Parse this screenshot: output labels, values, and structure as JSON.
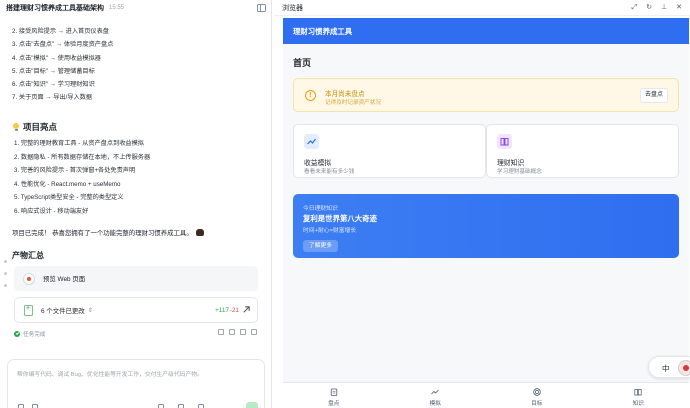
{
  "left": {
    "title": "搭建理财习惯养成工具基础架构",
    "time": "15:55",
    "steps": [
      "2. 接受风险提示 → 进入首页仪表盘",
      "3. 点击\"去盘点\" → 体验月度资产盘点",
      "4. 点击\"模拟\" → 使用收益模拟器",
      "5. 点击\"目标\" → 管理储蓄目标",
      "6. 点击\"知识\" → 学习理财知识",
      "7. 关于页面 → 导出/导入数据"
    ],
    "highlights_title": "项目亮点",
    "highlights": [
      "1. 完整的理财教育工具 - 从资产盘点到收益模拟",
      "2. 数据隐私 - 所有数据存储在本地，不上传服务器",
      "3. 完善的风险提示 - 首次弹窗+各处免责声明",
      "4. 性能优化 - React.memo + useMemo",
      "5. TypeScript类型安全 - 完整的类型定义",
      "6. 响应式设计 - 移动端友好"
    ],
    "done_text": "项目已完成！ 恭喜您拥有了一个功能完整的理财习惯养成工具。",
    "artifacts_title": "产物汇总",
    "preview_label": "预览 Web 页面",
    "changes_label": "6 个文件已更改",
    "additions": "+117",
    "deletions": "-21",
    "status_text": "任务完成",
    "composer_placeholder": "帮你编写代码、调试 Bug、优化性能等开发工作，交付生产级代码产物。"
  },
  "browser": {
    "title": "浏览器"
  },
  "app": {
    "header_title": "理财习惯养成工具",
    "page_title": "首页",
    "notice": {
      "title": "本月尚未盘点",
      "subtitle": "记得及时记录资产状况",
      "button": "去盘点"
    },
    "features": [
      {
        "title": "收益模拟",
        "subtitle": "看看未来能有多少钱"
      },
      {
        "title": "理财知识",
        "subtitle": "学习理财基础概念"
      }
    ],
    "banner": {
      "kicker": "今日理财知识",
      "title": "复利是世界第八大奇迹",
      "subtitle": "时间+耐心=财富增长",
      "button": "了解更多"
    },
    "float_label": "中",
    "tabs": [
      {
        "label": "盘点",
        "icon": "clipboard-icon"
      },
      {
        "label": "模拟",
        "icon": "trend-icon"
      },
      {
        "label": "目标",
        "icon": "target-icon"
      },
      {
        "label": "知识",
        "icon": "book-icon"
      }
    ]
  },
  "colors": {
    "brand_blue": "#2f6ef0",
    "warn_bg": "#fff8e6",
    "warn_text": "#c98a06",
    "add_green": "#2ea44f",
    "del_red": "#e5484d"
  }
}
